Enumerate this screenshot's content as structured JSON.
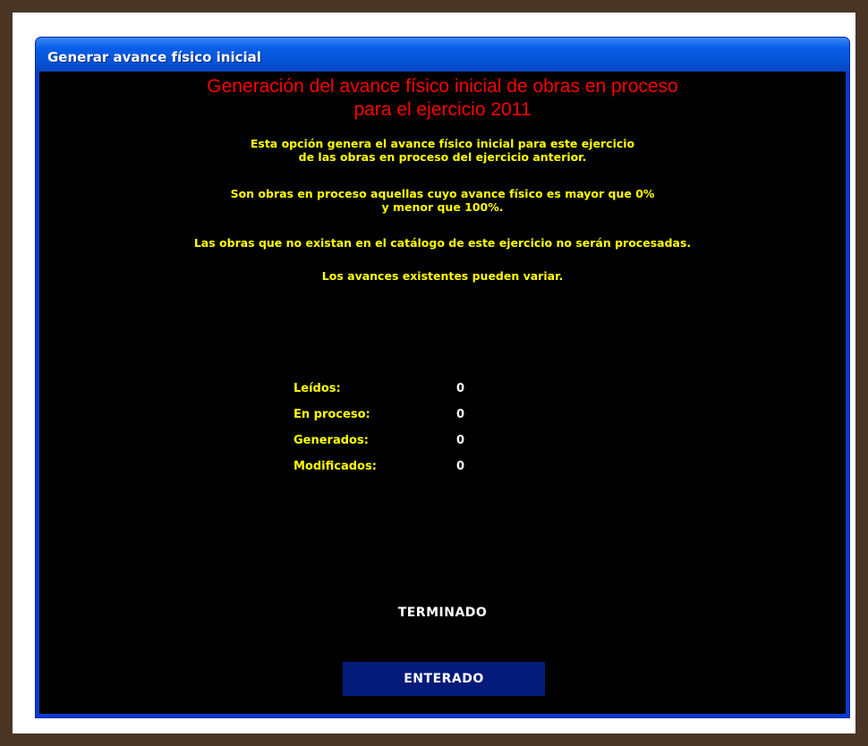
{
  "window": {
    "title": "Generar avance físico inicial"
  },
  "heading": {
    "line1": "Generación del avance físico inicial de obras en proceso",
    "line2": "para el ejercicio 2011"
  },
  "info": {
    "p1_line1": "Esta opción genera el avance físico inicial para este ejercicio",
    "p1_line2": "de las obras en proceso del ejercicio anterior.",
    "p2_line1": "Son obras en proceso aquellas cuyo avance físico es mayor que 0%",
    "p2_line2": "y menor que 100%.",
    "p3": "Las obras que no existan en el catálogo de este ejercicio no serán procesadas.",
    "p4": "Los avances existentes pueden variar."
  },
  "stats": [
    {
      "label": "Leídos:",
      "value": "0"
    },
    {
      "label": "En proceso:",
      "value": "0"
    },
    {
      "label": "Generados:",
      "value": "0"
    },
    {
      "label": "Modificados:",
      "value": "0"
    }
  ],
  "status": "TERMINADO",
  "button": {
    "label": "ENTERADO"
  },
  "colors": {
    "heading": "#ff0000",
    "info": "#ffff00",
    "client_bg": "#000000",
    "button_bg": "#041a7a",
    "frame_bg": "#4a3524"
  }
}
